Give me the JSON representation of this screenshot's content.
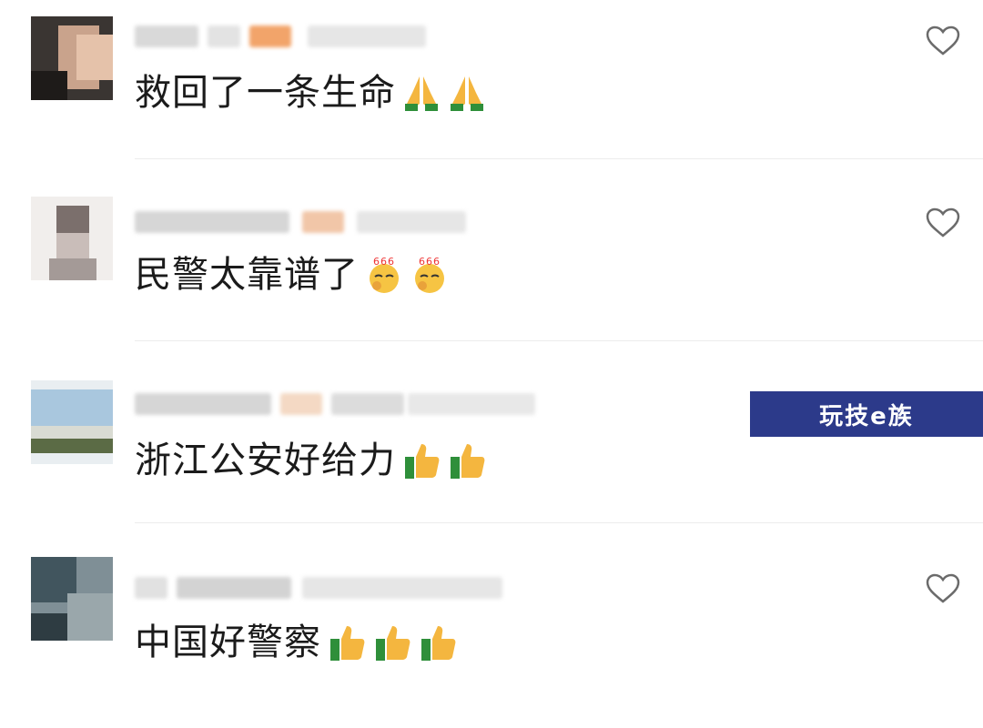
{
  "comments": [
    {
      "text": "救回了一条生命",
      "emoji": "folded-hands",
      "emoji_count": 2
    },
    {
      "text": "民警太靠谱了",
      "emoji": "666-smirk",
      "emoji_count": 2
    },
    {
      "text": "浙江公安好给力",
      "emoji": "thumbs-up",
      "emoji_count": 2
    },
    {
      "text": "中国好警察",
      "emoji": "thumbs-up",
      "emoji_count": 3
    }
  ],
  "icons": {
    "like": "heart-outline-icon"
  },
  "watermark": {
    "text": "玩技e族"
  },
  "colors": {
    "text": "#1b1b1b",
    "divider": "#ececec",
    "heart": "#6b6b6b",
    "watermark_bg": "#2c3a8a"
  }
}
